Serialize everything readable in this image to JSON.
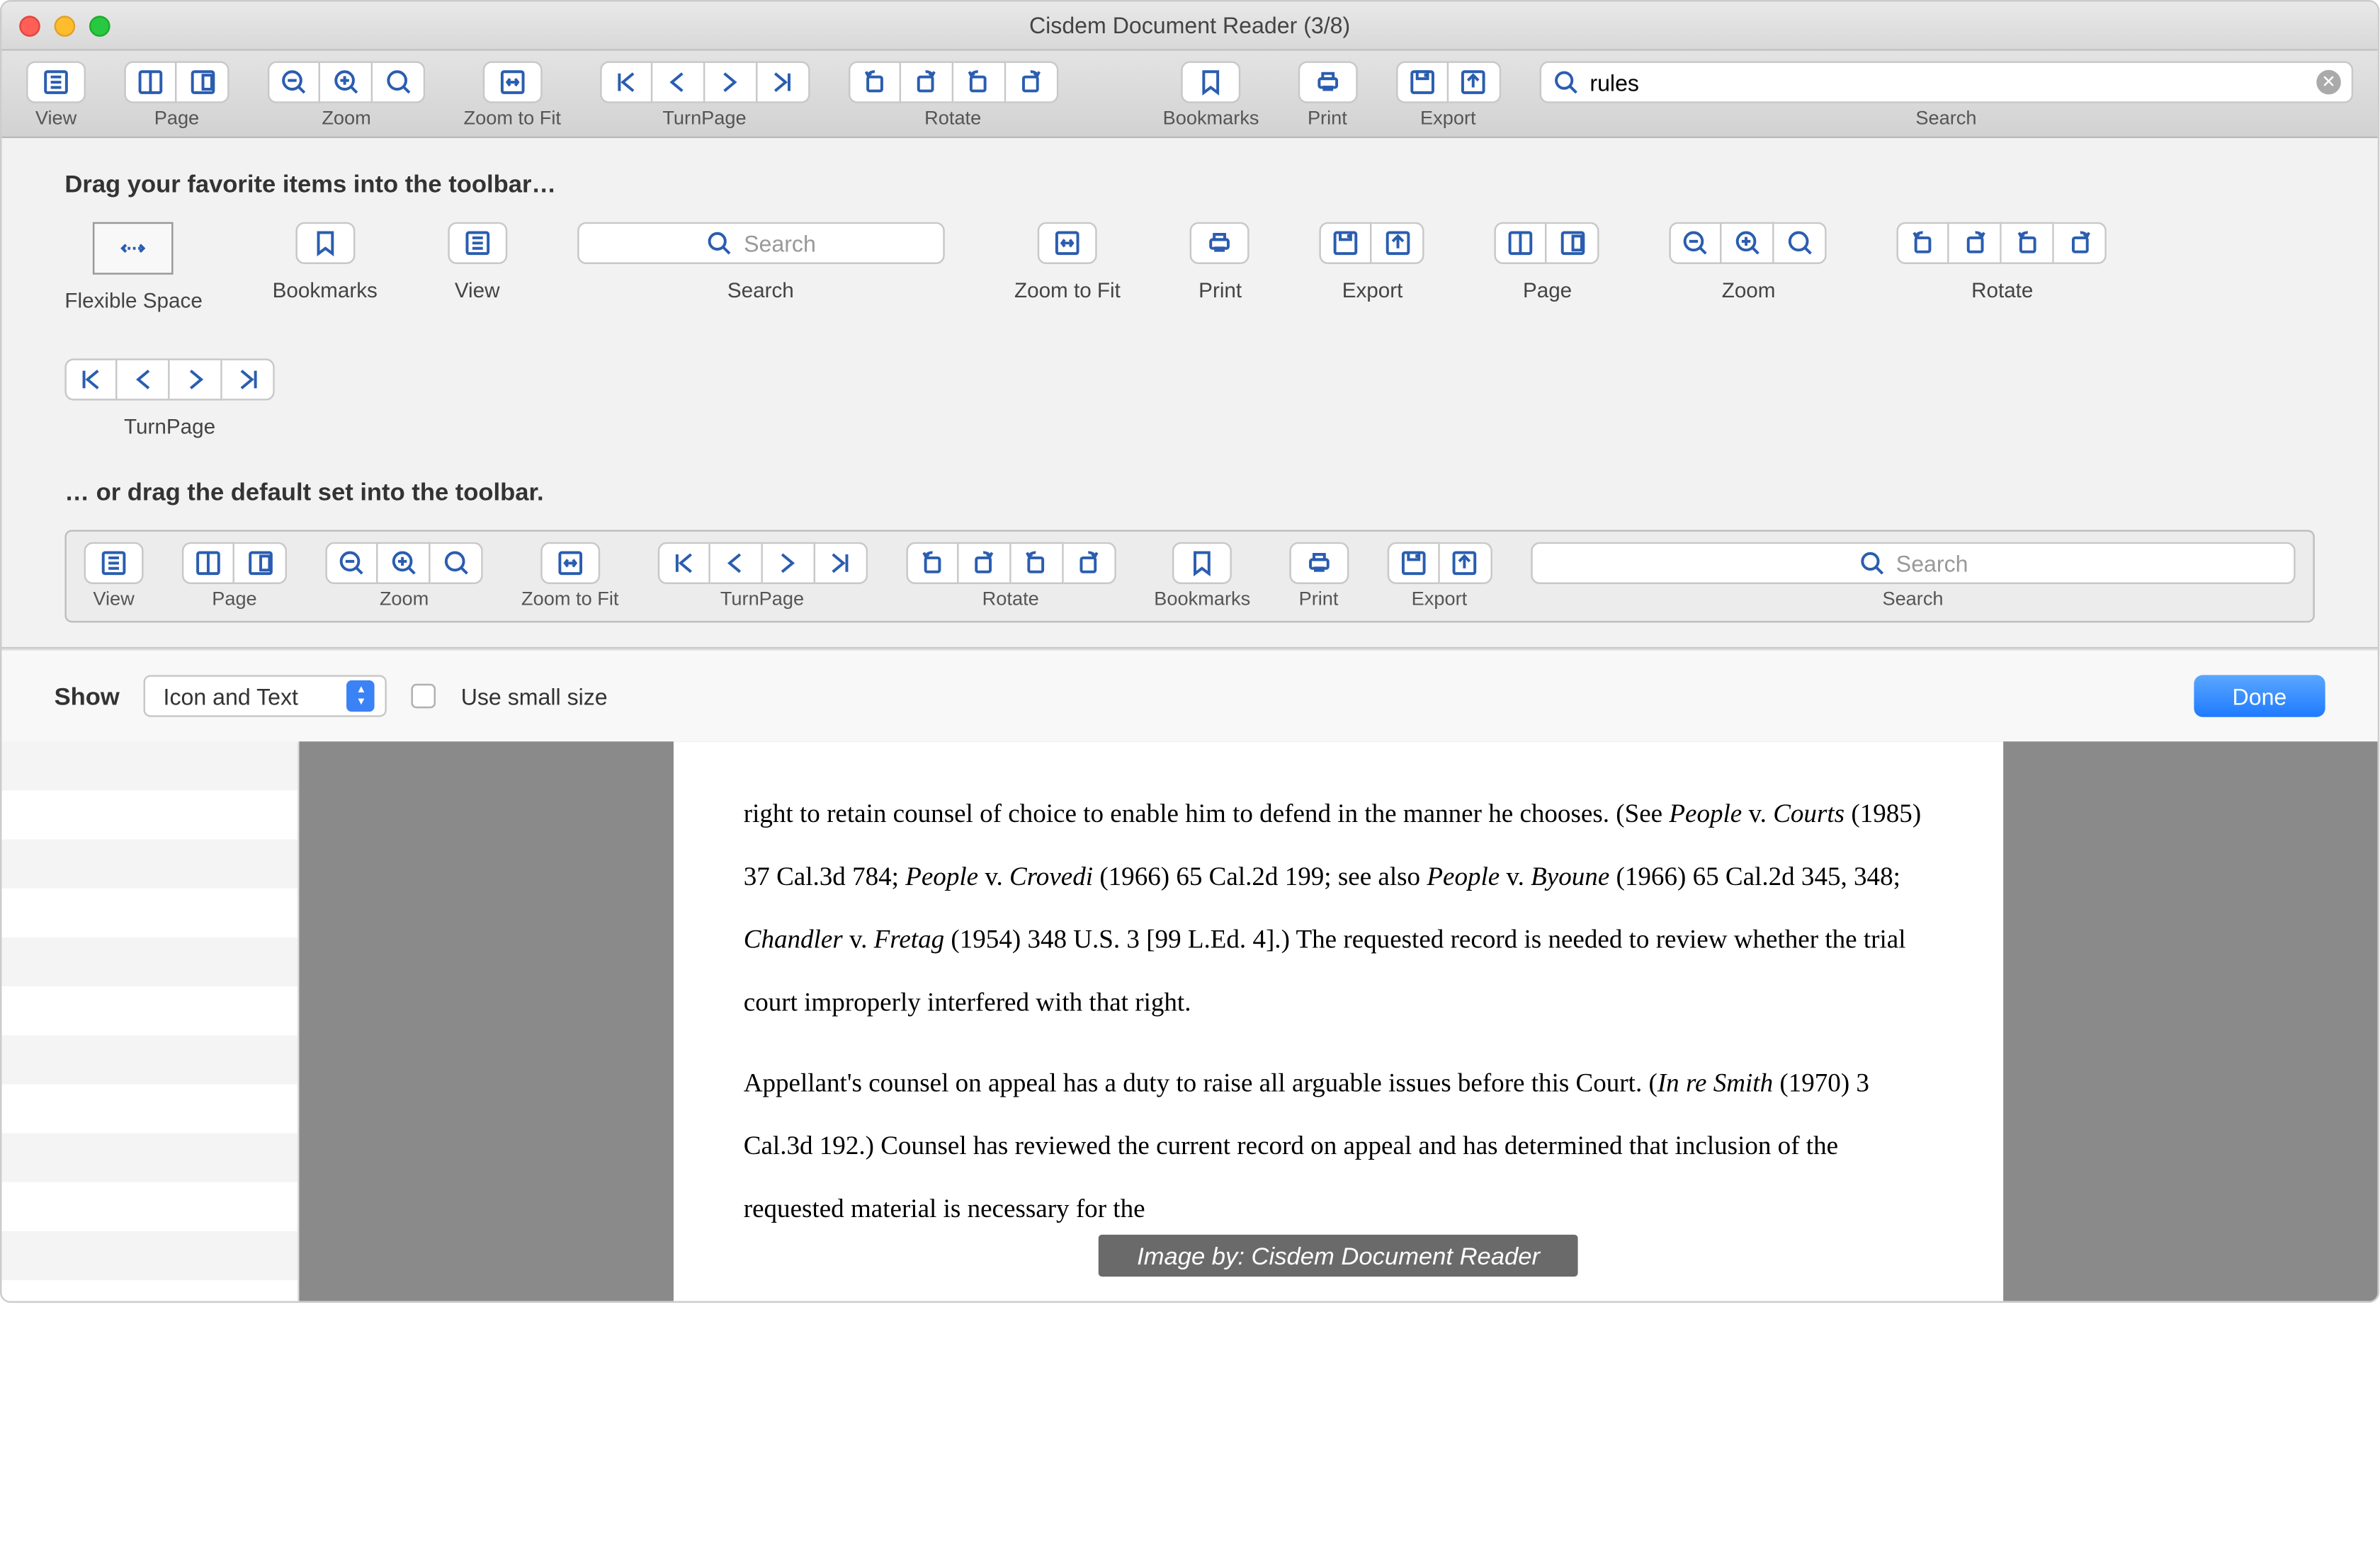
{
  "window": {
    "title": "Cisdem Document Reader (3/8)"
  },
  "toolbar": {
    "groups": {
      "view": "View",
      "page": "Page",
      "zoom": "Zoom",
      "zoom_to_fit": "Zoom to Fit",
      "turnpage": "TurnPage",
      "rotate": "Rotate",
      "bookmarks": "Bookmarks",
      "print": "Print",
      "export": "Export",
      "search": "Search"
    },
    "search_value": "rules"
  },
  "customize": {
    "heading_drag": "Drag your favorite items into the toolbar…",
    "heading_default": "… or drag the default set into the toolbar.",
    "items": {
      "flexible_space": "Flexible Space",
      "bookmarks": "Bookmarks",
      "view": "View",
      "search": "Search",
      "search_placeholder": "Search",
      "zoom_to_fit": "Zoom to Fit",
      "print": "Print",
      "export": "Export",
      "page": "Page",
      "zoom": "Zoom",
      "rotate": "Rotate",
      "turnpage": "TurnPage"
    }
  },
  "footer": {
    "show_label": "Show",
    "select_value": "Icon and Text",
    "small_size_label": "Use small size",
    "done": "Done"
  },
  "document": {
    "para1_a": "right to retain counsel of choice to enable him to defend in the manner he chooses. (See ",
    "para1_b": "People",
    "para1_c": " v. ",
    "para1_d": "Courts",
    "para1_e": " (1985) 37 Cal.3d 784; ",
    "para1_f": "People",
    "para1_g": " v. ",
    "para1_h": "Crovedi",
    "para1_i": " (1966) 65 Cal.2d 199; see also ",
    "para1_j": "People",
    "para1_k": " v. ",
    "para1_l": "Byoune",
    "para1_m": " (1966) 65 Cal.2d 345, 348; ",
    "para1_n": "Chandler",
    "para1_o": " v. ",
    "para1_p": "Fretag",
    "para1_q": " (1954) 348 U.S. 3 [99 L.Ed. 4].)  The requested record is needed to review whether the trial court improperly interfered with that right.",
    "para2_a": "Appellant's counsel on appeal has a duty to raise all arguable issues before this Court. (",
    "para2_b": "In re Smith",
    "para2_c": " (1970) 3 Cal.3d 192.)  Counsel has reviewed the current record on appeal and has determined that inclusion of the requested material is necessary for the"
  },
  "watermark": "Image by: Cisdem Document Reader"
}
